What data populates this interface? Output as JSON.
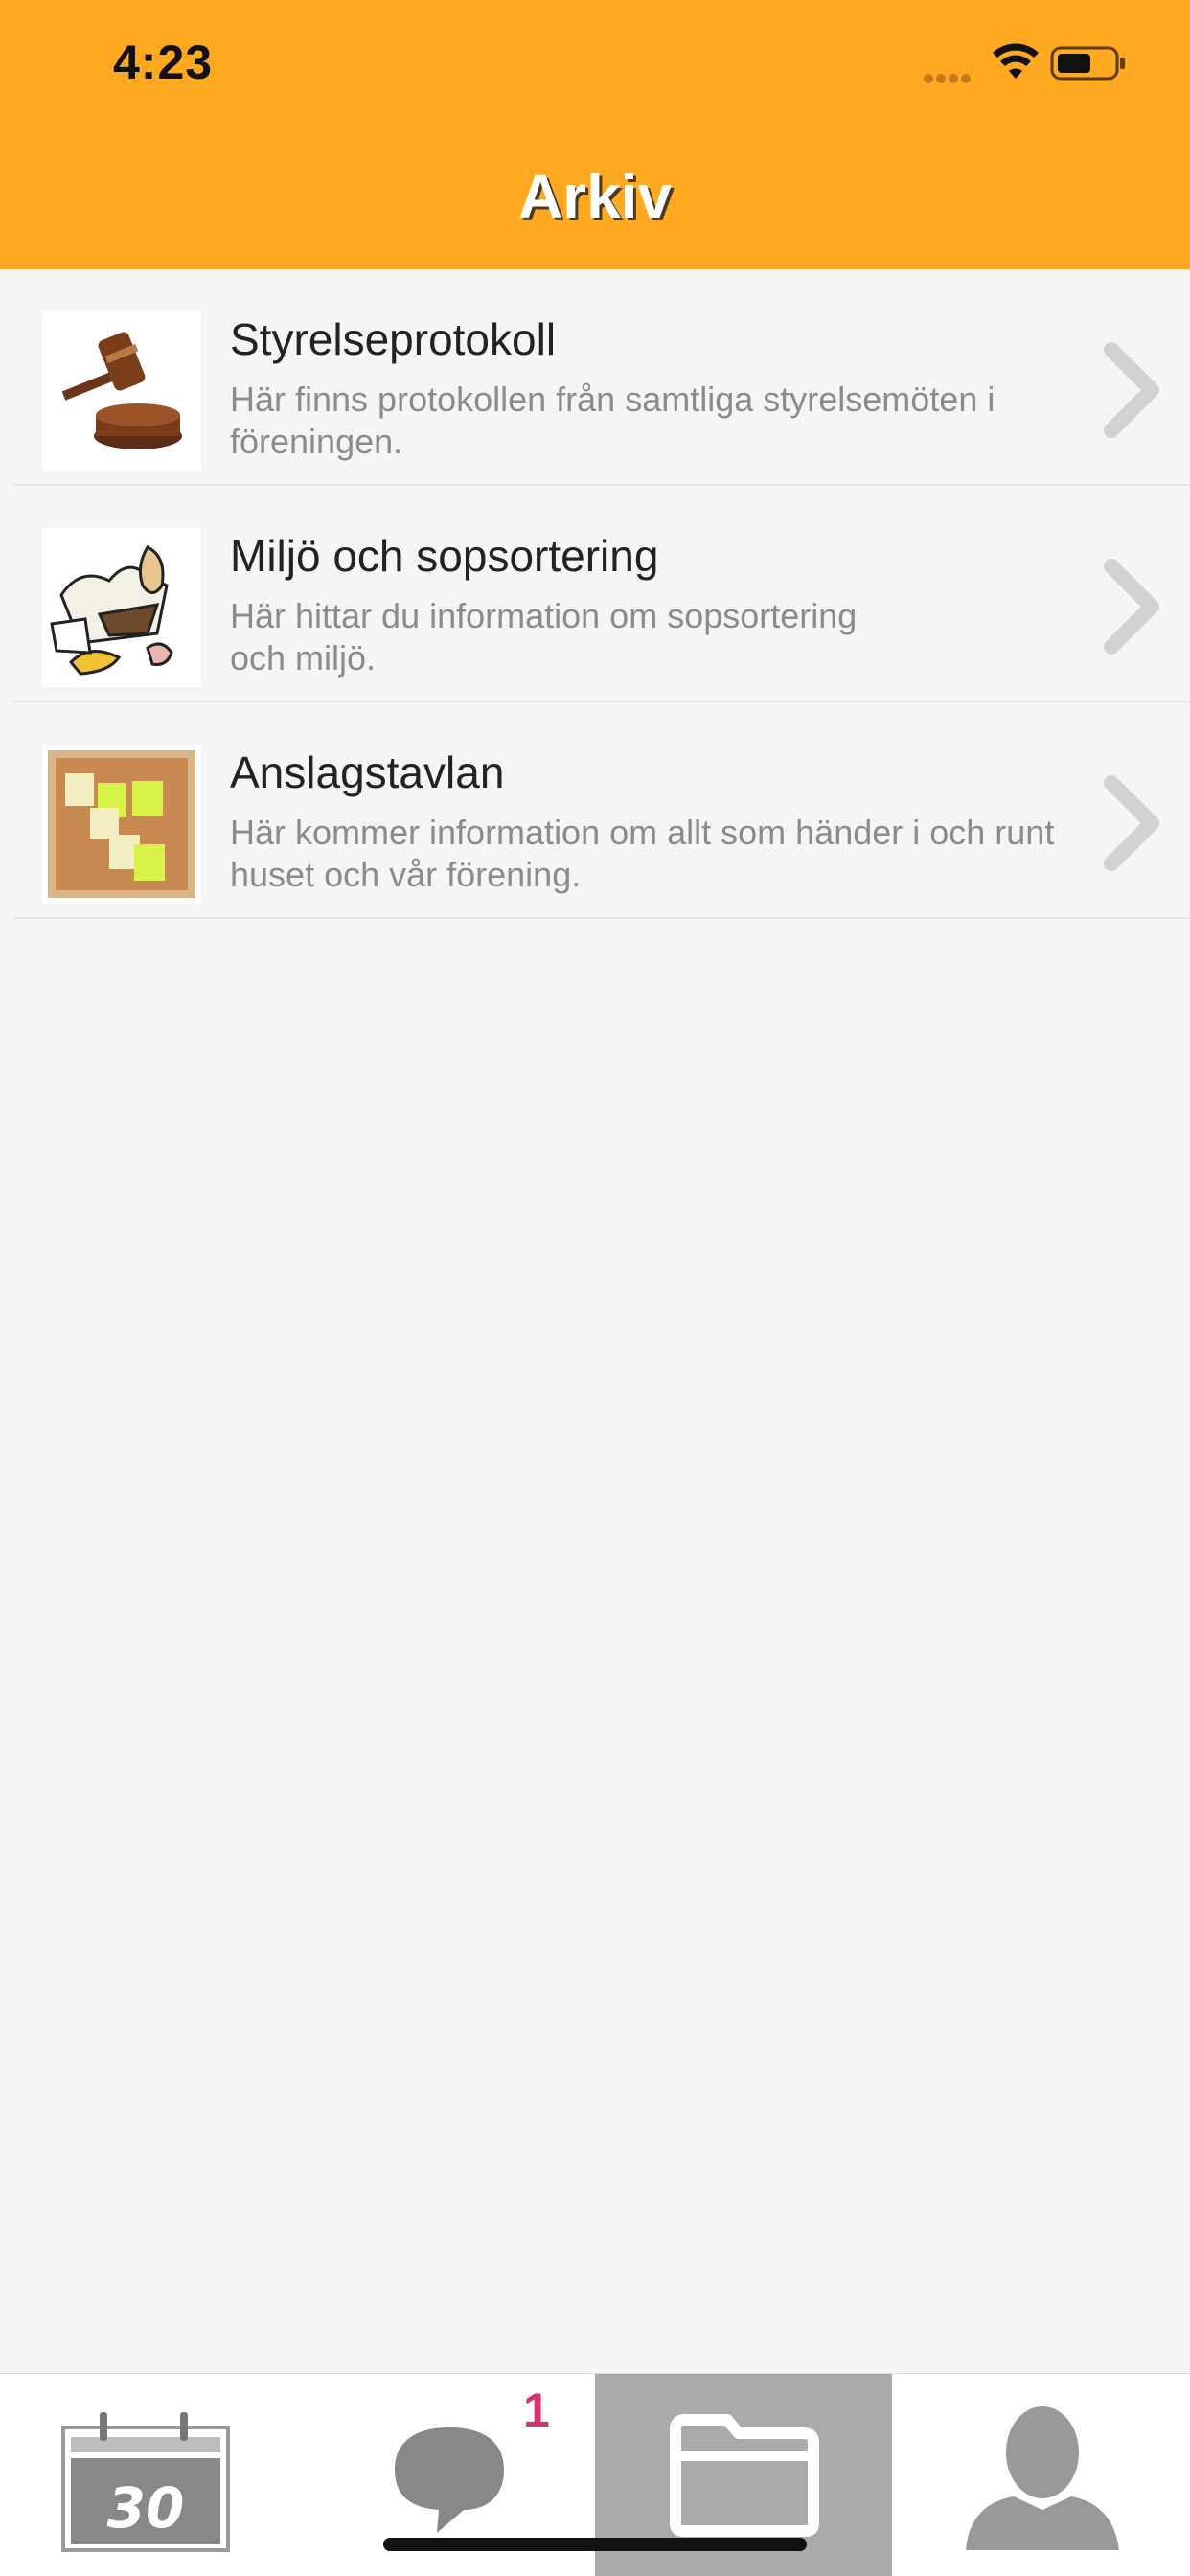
{
  "status_bar": {
    "time": "4:23"
  },
  "header": {
    "title": "Arkiv",
    "background_color": "#ffa821"
  },
  "list": {
    "items": [
      {
        "title": "Styrelseprotokoll",
        "description": "Här finns protokollen från samtliga styrelsemöten i föreningen.",
        "thumbnail": "gavel-image"
      },
      {
        "title": "Miljö och sopsortering",
        "description": "Här hittar du information om sopsortering och miljö.",
        "thumbnail": "waste-image"
      },
      {
        "title": "Anslagstavlan",
        "description": "Här kommer information om allt som händer i och runt huset och vår förening.",
        "thumbnail": "corkboard-image"
      }
    ]
  },
  "tabbar": {
    "calendar_day": "30",
    "messages_badge": "1",
    "active_tab": "archive",
    "tabs": [
      "calendar-icon",
      "chat-bubble-icon",
      "folder-icon",
      "person-icon"
    ],
    "accent_color": "#d6336c"
  }
}
